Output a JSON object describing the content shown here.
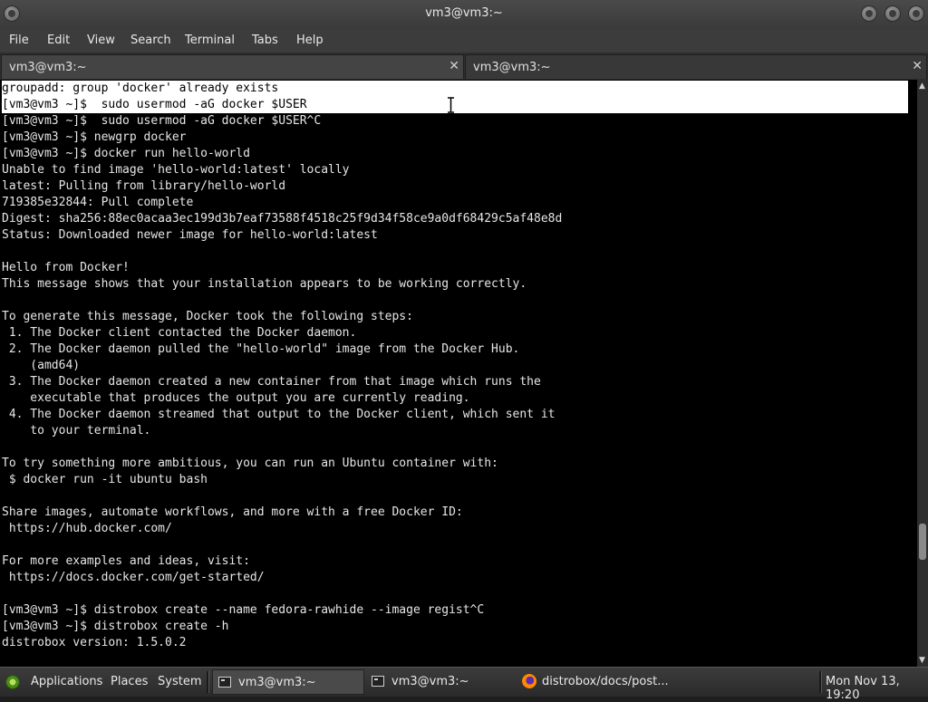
{
  "window": {
    "title": "vm3@vm3:~"
  },
  "menu": [
    "File",
    "Edit",
    "View",
    "Search",
    "Terminal",
    "Tabs",
    "Help"
  ],
  "tabs": [
    {
      "label": "vm3@vm3:~",
      "close": "✕",
      "active": true
    },
    {
      "label": "vm3@vm3:~",
      "close": "✕",
      "active": false
    }
  ],
  "terminal": {
    "lines": [
      "groupadd: group 'docker' already exists",
      "[vm3@vm3 ~]$  sudo usermod -aG docker $USER",
      "[vm3@vm3 ~]$  sudo usermod -aG docker $USER^C",
      "[vm3@vm3 ~]$ newgrp docker",
      "[vm3@vm3 ~]$ docker run hello-world",
      "Unable to find image 'hello-world:latest' locally",
      "latest: Pulling from library/hello-world",
      "719385e32844: Pull complete",
      "Digest: sha256:88ec0acaa3ec199d3b7eaf73588f4518c25f9d34f58ce9a0df68429c5af48e8d",
      "Status: Downloaded newer image for hello-world:latest",
      "",
      "Hello from Docker!",
      "This message shows that your installation appears to be working correctly.",
      "",
      "To generate this message, Docker took the following steps:",
      " 1. The Docker client contacted the Docker daemon.",
      " 2. The Docker daemon pulled the \"hello-world\" image from the Docker Hub.",
      "    (amd64)",
      " 3. The Docker daemon created a new container from that image which runs the",
      "    executable that produces the output you are currently reading.",
      " 4. The Docker daemon streamed that output to the Docker client, which sent it",
      "    to your terminal.",
      "",
      "To try something more ambitious, you can run an Ubuntu container with:",
      " $ docker run -it ubuntu bash",
      "",
      "Share images, automate workflows, and more with a free Docker ID:",
      " https://hub.docker.com/",
      "",
      "For more examples and ideas, visit:",
      " https://docs.docker.com/get-started/",
      "",
      "[vm3@vm3 ~]$ distrobox create --name fedora-rawhide --image regist^C",
      "[vm3@vm3 ~]$ distrobox create -h",
      "distrobox version: 1.5.0.2"
    ],
    "selected_lines": [
      0,
      1
    ]
  },
  "scrollbar": {
    "up": "▲",
    "down": "▼",
    "position": 0.82
  },
  "taskbar": {
    "applications": "Applications",
    "places": "Places",
    "system": "System",
    "tasks": [
      {
        "label": "vm3@vm3:~",
        "icon": "terminal-icon",
        "active": true
      },
      {
        "label": "vm3@vm3:~",
        "icon": "terminal-icon",
        "active": false
      },
      {
        "label": "distrobox/docs/post...",
        "icon": "firefox-icon",
        "active": false
      }
    ],
    "clock": "Mon Nov 13, 19:20"
  }
}
